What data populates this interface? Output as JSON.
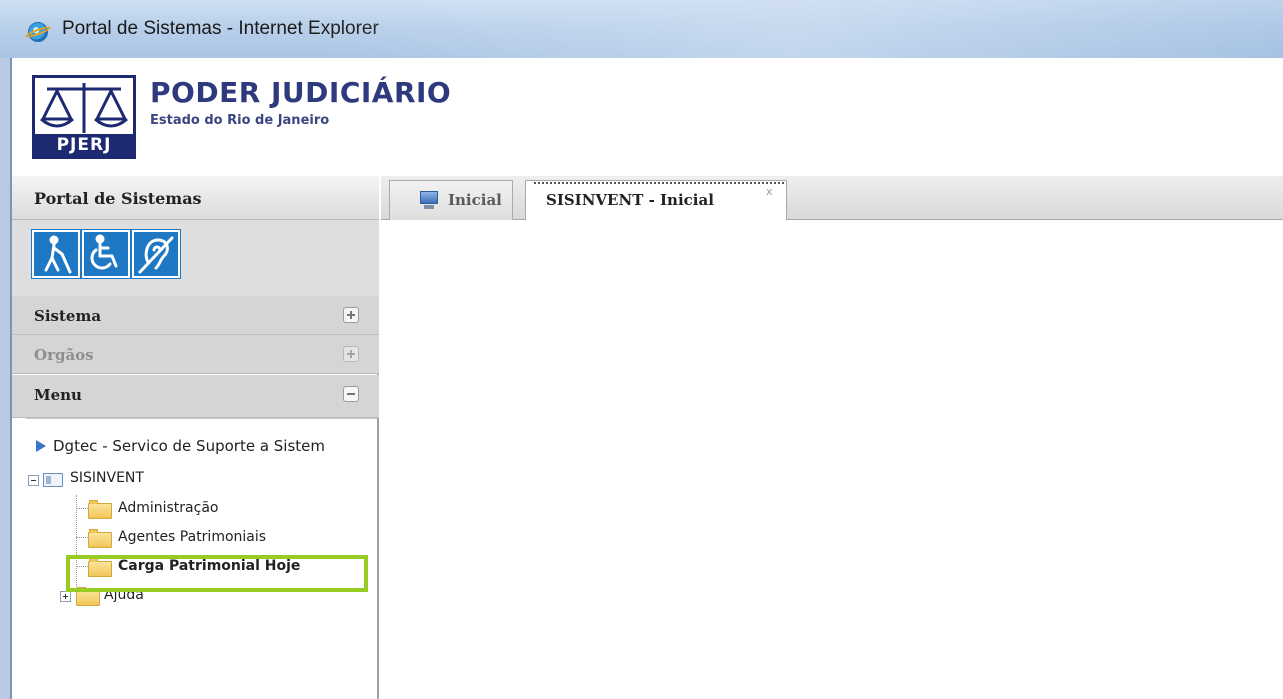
{
  "window": {
    "title": "Portal de Sistemas - Internet Explorer",
    "browser_icon": "internet-explorer-icon"
  },
  "header": {
    "org_name": "PODER JUDICIÁRIO",
    "org_subtitle": "Estado do Rio de Janeiro",
    "logo_text": "PJERJ"
  },
  "sidebar": {
    "title": "Portal de Sistemas",
    "accessibility_icons": [
      "visual-impairment-icon",
      "wheelchair-icon",
      "hearing-impairment-icon"
    ],
    "sections": [
      {
        "label": "Sistema",
        "state": "collapsed"
      },
      {
        "label": "Orgãos",
        "state": "collapsed-disabled"
      },
      {
        "label": "Menu",
        "state": "expanded"
      }
    ],
    "menu": {
      "root_item": "Dgtec - Servico de Suporte a Sistem",
      "tree": {
        "system": "SISINVENT",
        "items": [
          "Administração",
          "Agentes Patrimoniais",
          "Carga Patrimonial Hoje",
          "Ajuda"
        ],
        "highlighted": "Carga Patrimonial Hoje"
      }
    }
  },
  "tabs": [
    {
      "label": "Inicial",
      "active": false
    },
    {
      "label": "SISINVENT - Inicial",
      "active": true,
      "close": "x"
    }
  ],
  "colors": {
    "highlight": "#99cc22",
    "brand": "#1d2a72",
    "accessibility": "#1f78c4"
  }
}
